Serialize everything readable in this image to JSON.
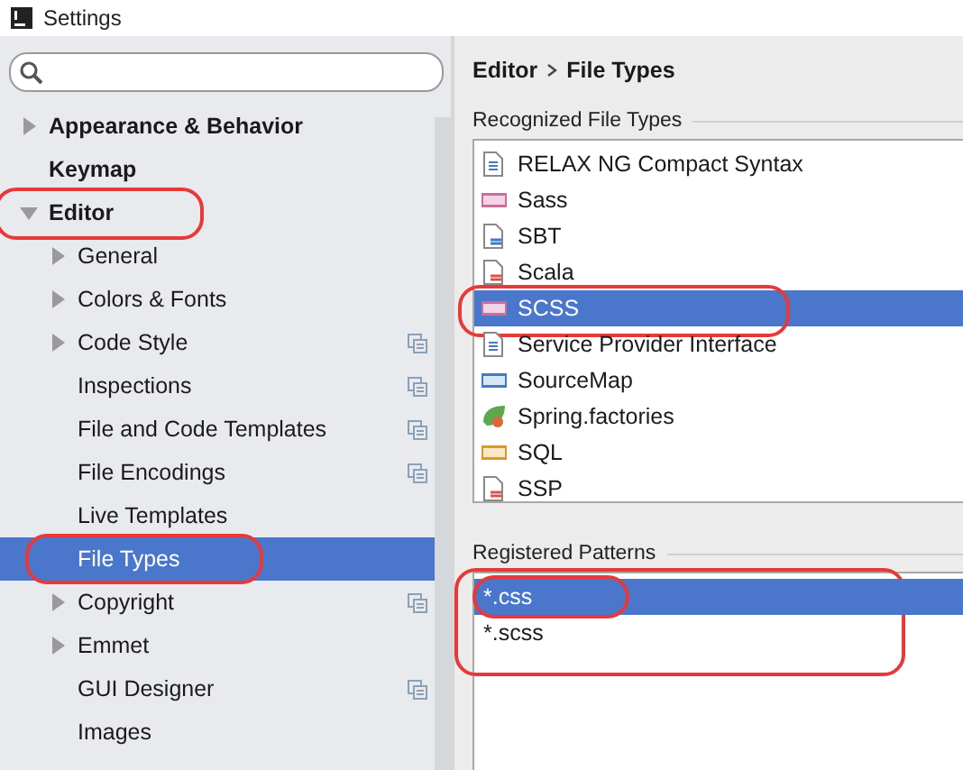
{
  "window": {
    "title": "Settings"
  },
  "sidebar": {
    "items": [
      {
        "label": "Appearance & Behavior",
        "kind": "folder",
        "expanded": false,
        "scoped": false,
        "selected": false,
        "circled": false
      },
      {
        "label": "Keymap",
        "kind": "leaf",
        "scoped": false,
        "selected": false,
        "circled": false
      },
      {
        "label": "Editor",
        "kind": "folder",
        "expanded": true,
        "scoped": false,
        "selected": false,
        "circled": true,
        "children": [
          {
            "label": "General",
            "kind": "folder",
            "expanded": false,
            "scoped": false,
            "selected": false,
            "circled": false
          },
          {
            "label": "Colors & Fonts",
            "kind": "folder",
            "expanded": false,
            "scoped": false,
            "selected": false,
            "circled": false
          },
          {
            "label": "Code Style",
            "kind": "folder",
            "expanded": false,
            "scoped": true,
            "selected": false,
            "circled": false
          },
          {
            "label": "Inspections",
            "kind": "leaf",
            "scoped": true,
            "selected": false,
            "circled": false
          },
          {
            "label": "File and Code Templates",
            "kind": "leaf",
            "scoped": true,
            "selected": false,
            "circled": false
          },
          {
            "label": "File Encodings",
            "kind": "leaf",
            "scoped": true,
            "selected": false,
            "circled": false
          },
          {
            "label": "Live Templates",
            "kind": "leaf",
            "scoped": false,
            "selected": false,
            "circled": false
          },
          {
            "label": "File Types",
            "kind": "leaf",
            "scoped": false,
            "selected": true,
            "circled": true
          },
          {
            "label": "Copyright",
            "kind": "folder",
            "expanded": false,
            "scoped": true,
            "selected": false,
            "circled": false
          },
          {
            "label": "Emmet",
            "kind": "folder",
            "expanded": false,
            "scoped": false,
            "selected": false,
            "circled": false
          },
          {
            "label": "GUI Designer",
            "kind": "leaf",
            "scoped": true,
            "selected": false,
            "circled": false
          },
          {
            "label": "Images",
            "kind": "leaf",
            "scoped": false,
            "selected": false,
            "circled": false
          }
        ]
      }
    ]
  },
  "breadcrumb": [
    "Editor",
    "File Types"
  ],
  "recognized_file_types": {
    "title": "Recognized File Types",
    "items": [
      {
        "label": "RELAX NG Compact Syntax",
        "kind": "text",
        "selected": false,
        "circled": false
      },
      {
        "label": "Sass",
        "kind": "sass",
        "selected": false,
        "circled": false
      },
      {
        "label": "SBT",
        "kind": "sbt",
        "selected": false,
        "circled": false
      },
      {
        "label": "Scala",
        "kind": "scala",
        "selected": false,
        "circled": false
      },
      {
        "label": "SCSS",
        "kind": "sass",
        "selected": true,
        "circled": true
      },
      {
        "label": "Service Provider Interface",
        "kind": "text",
        "selected": false,
        "circled": false
      },
      {
        "label": "SourceMap",
        "kind": "json",
        "selected": false,
        "circled": false
      },
      {
        "label": "Spring.factories",
        "kind": "spring",
        "selected": false,
        "circled": false
      },
      {
        "label": "SQL",
        "kind": "sql",
        "selected": false,
        "circled": false
      },
      {
        "label": "SSP",
        "kind": "scala",
        "selected": false,
        "circled": false
      }
    ]
  },
  "registered_patterns": {
    "title": "Registered Patterns",
    "circled": true,
    "items": [
      {
        "label": "*.css",
        "selected": true,
        "circled": true
      },
      {
        "label": "*.scss",
        "selected": false,
        "circled": false
      }
    ]
  }
}
